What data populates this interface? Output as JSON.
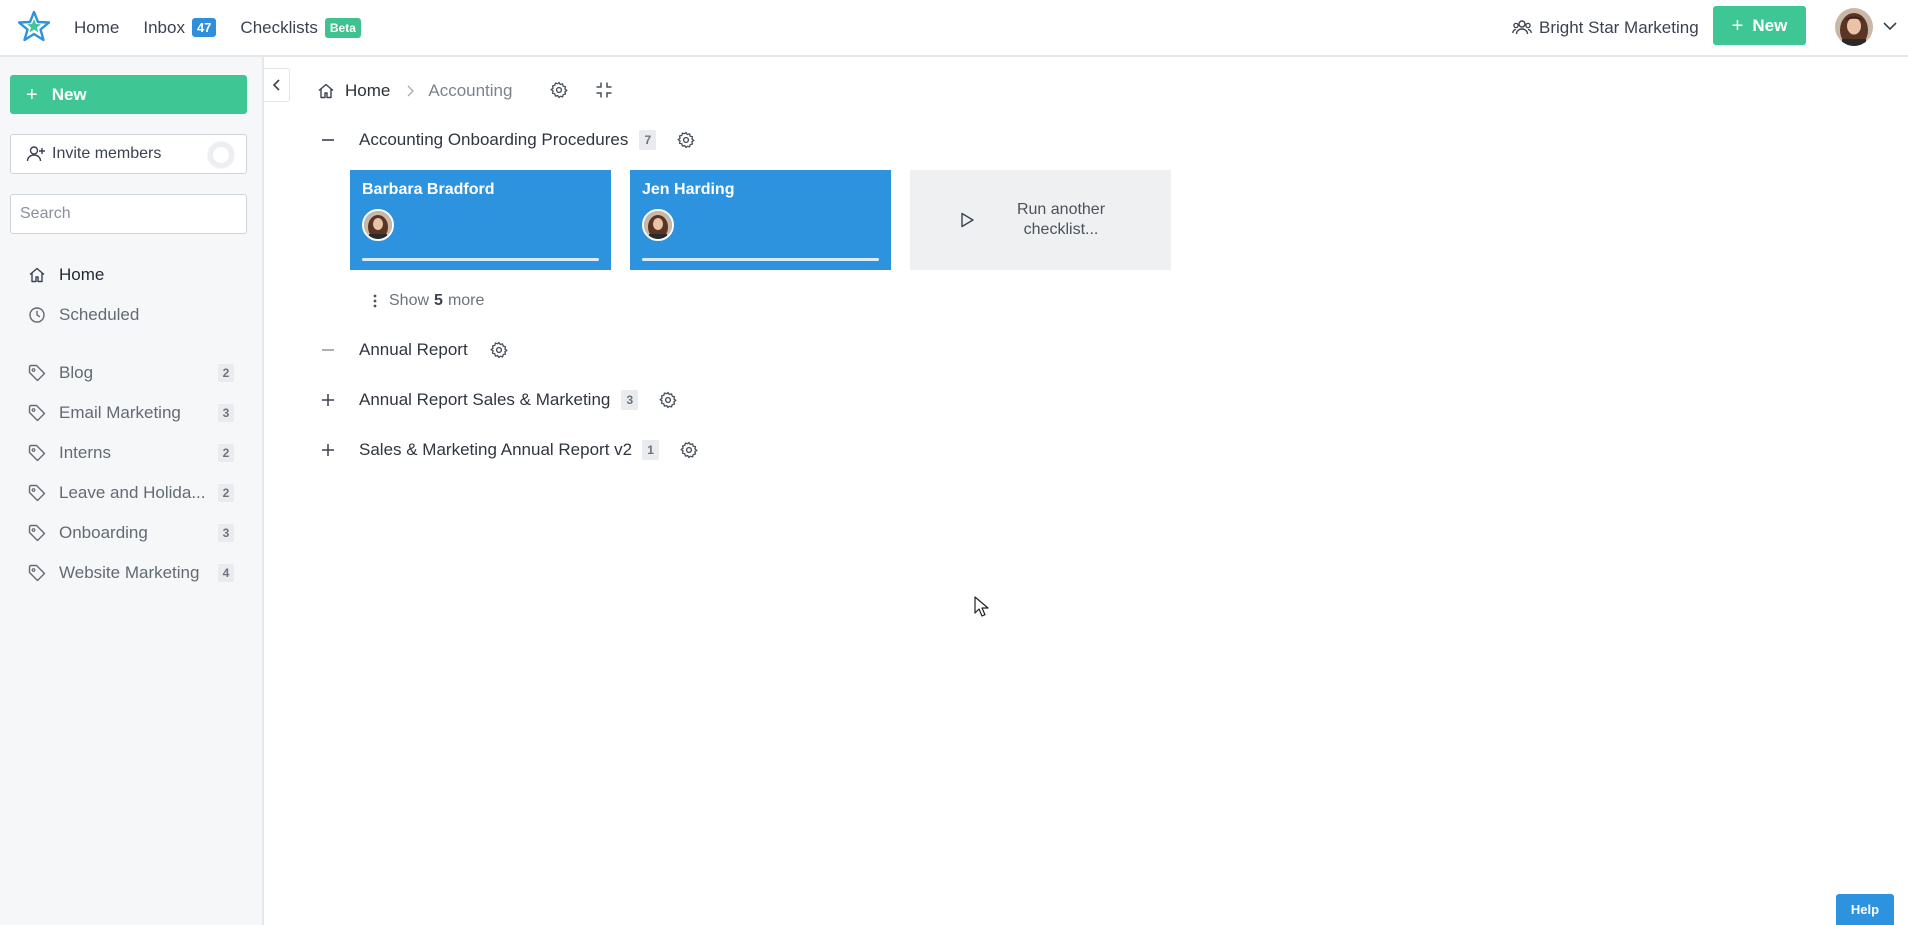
{
  "topbar": {
    "nav": {
      "home": "Home",
      "inbox": "Inbox",
      "inbox_count": "47",
      "checklists": "Checklists",
      "checklists_badge": "Beta"
    },
    "organization": "Bright Star Marketing",
    "new_label": "New"
  },
  "sidebar": {
    "new_label": "New",
    "invite_label": "Invite members",
    "search_placeholder": "Search",
    "nav": [
      {
        "label": "Home",
        "icon": "home-icon"
      },
      {
        "label": "Scheduled",
        "icon": "clock-icon"
      }
    ],
    "tags": [
      {
        "label": "Blog",
        "count": "2"
      },
      {
        "label": "Email Marketing",
        "count": "3"
      },
      {
        "label": "Interns",
        "count": "2"
      },
      {
        "label": "Leave and Holida...",
        "count": "2"
      },
      {
        "label": "Onboarding",
        "count": "3"
      },
      {
        "label": "Website Marketing",
        "count": "4"
      }
    ]
  },
  "breadcrumb": {
    "home": "Home",
    "current": "Accounting"
  },
  "groups": [
    {
      "name": "Accounting Onboarding Procedures",
      "count": "7",
      "expanded": true,
      "runs": [
        {
          "name": "Barbara Bradford"
        },
        {
          "name": "Jen Harding"
        }
      ],
      "run_another": "Run another checklist...",
      "show_more": {
        "prefix": "Show",
        "count": "5",
        "suffix": "more"
      }
    },
    {
      "name": "Annual Report",
      "count": "",
      "expanded": true
    },
    {
      "name": "Annual Report Sales & Marketing",
      "count": "3",
      "expanded": false
    },
    {
      "name": "Sales & Marketing Annual Report v2",
      "count": "1",
      "expanded": false
    }
  ],
  "help_label": "Help",
  "colors": {
    "accent_green": "#3ec795",
    "accent_blue": "#2e93de"
  }
}
